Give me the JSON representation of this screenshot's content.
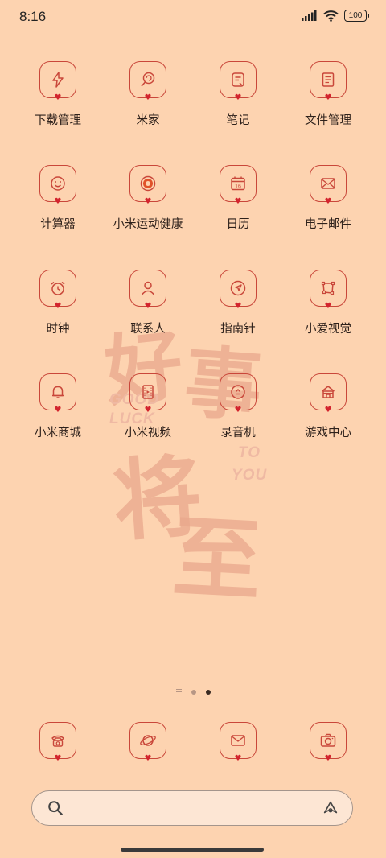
{
  "status": {
    "time": "8:16",
    "battery": "100"
  },
  "wallpaper": {
    "chars": [
      "好",
      "事",
      "将",
      "至"
    ],
    "english": [
      "GOOD",
      "LUCK",
      "TO",
      "YOU"
    ]
  },
  "apps": [
    {
      "label": "下载管理",
      "icon": "lightning-icon"
    },
    {
      "label": "米家",
      "icon": "lollipop-icon"
    },
    {
      "label": "笔记",
      "icon": "note-icon"
    },
    {
      "label": "文件管理",
      "icon": "file-icon"
    },
    {
      "label": "计算器",
      "icon": "smiley-icon"
    },
    {
      "label": "小米运动健康",
      "icon": "ring-icon"
    },
    {
      "label": "日历",
      "icon": "calendar-icon"
    },
    {
      "label": "电子邮件",
      "icon": "envelope-icon"
    },
    {
      "label": "时钟",
      "icon": "alarm-clock-icon"
    },
    {
      "label": "联系人",
      "icon": "person-icon"
    },
    {
      "label": "指南针",
      "icon": "compass-icon"
    },
    {
      "label": "小爱视觉",
      "icon": "scan-icon"
    },
    {
      "label": "小米商城",
      "icon": "bell-icon"
    },
    {
      "label": "小米视频",
      "icon": "film-icon"
    },
    {
      "label": "录音机",
      "icon": "recorder-icon"
    },
    {
      "label": "游戏中心",
      "icon": "castle-icon"
    }
  ],
  "calendar_day": "16",
  "dock": [
    {
      "name": "phone-icon"
    },
    {
      "name": "planet-icon"
    },
    {
      "name": "mail-icon"
    },
    {
      "name": "camera-icon"
    }
  ],
  "search": {
    "placeholder": ""
  },
  "colors": {
    "background": "#fdd3b0",
    "accent": "#c9473a",
    "heart": "#d3242e"
  }
}
